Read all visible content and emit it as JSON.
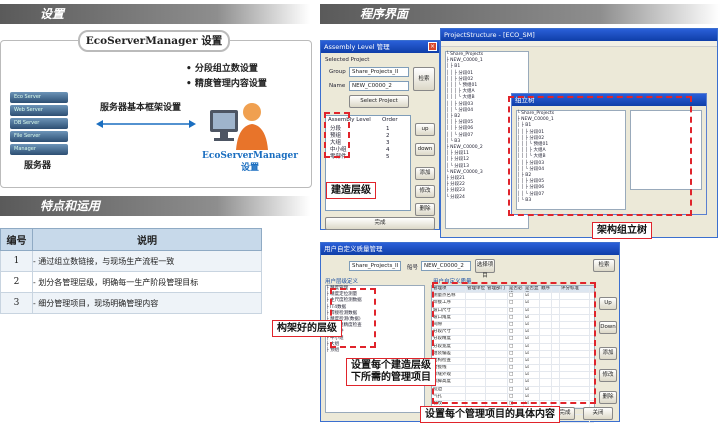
{
  "headers": {
    "settings": "设置",
    "program": "程序界面",
    "features": "特点和运用"
  },
  "setup": {
    "title": "EcoServerManager 设置",
    "bullets": [
      "分段组立数设置",
      "精度管理内容设置"
    ],
    "frame_label": "服务器基本框架设置",
    "server_label": "服务器",
    "manager_label_1": "EcoServerManager",
    "manager_label_2": "设置",
    "server_units": [
      "Eco Server",
      "Web Server",
      "DB Server",
      "File Server",
      "Manager"
    ]
  },
  "features_table": {
    "headers": [
      "编号",
      "说明"
    ],
    "rows": [
      {
        "num": "1",
        "text": "-   通过组立数链接，与现场生产流程一致"
      },
      {
        "num": "2",
        "text": "-   划分各管理层级，明确每一生产阶段管理目标"
      },
      {
        "num": "3",
        "text": "-   细分管理项目，现场明确管理内容"
      }
    ]
  },
  "assembly_window": {
    "title": "Assembly Level 管理",
    "selected_project": "Selected Project",
    "group_label": "Group",
    "group_value": "Share_Projects_II",
    "name_label": "Name",
    "name_value": "NEW_C0000_2",
    "select_button": "Select Project",
    "change_button": "检索",
    "col_level": "Assembly Level",
    "col_order": "Order",
    "levels": [
      "分段",
      "预组",
      "大组",
      "中小组",
      "零部件"
    ],
    "orders": [
      "1",
      "2",
      "3",
      "4",
      "5"
    ],
    "side_buttons": [
      "up",
      "down",
      "添加",
      "修改",
      "删除"
    ],
    "ok_button": "完成"
  },
  "main_window": {
    "title": "ProjectStructure - [ECO_SM]",
    "dialog_title": "组立树",
    "tree_items": [
      "└ Share_Projects",
      "  ├ NEW_C0000_1",
      "  │ ├ B1",
      "  │ │ ├ 分段01",
      "  │ │ ├ 分段02",
      "  │ │ │ └ 预组01",
      "  │ │ │   ├ 大组A",
      "  │ │ │   └ 大组B",
      "  │ │ ├ 分段03",
      "  │ │ └ 分段04",
      "  │ ├ B2",
      "  │ │ ├ 分段05",
      "  │ │ ├ 分段06",
      "  │ │ └ 分段07",
      "  │ └ B3",
      "  ├ NEW_C0000_2",
      "  │ ├ 分段11",
      "  │ ├ 分段12",
      "  │ └ 分段13",
      "  └ NEW_C0000_3",
      "    ├ 分段21",
      "    ├ 分段22",
      "    ├ 分段23",
      "    └ 分段24"
    ]
  },
  "user_window": {
    "title": "用户自定义质量管理",
    "group_value": "Share_Projects_II",
    "name_label": "船号",
    "name_value": "NEW_C0000_2",
    "select_button": "选择项目",
    "change_button": "检索",
    "left_title": "用户层级定义",
    "right_title": "用户自定义质量",
    "left_items": [
      "精度管理",
      "精度定位测量",
      "主尺度检测数据",
      "IT4数据",
      "焊接检测数据",
      "精度检测(数据)",
      "工作组精度检查",
      "零部件",
      "中小组",
      "大组",
      "预组"
    ],
    "grid_headers": [
      "管理项",
      "管理单位",
      "管理部门",
      "是否必填",
      "是否显示",
      "顺序",
      "",
      "评分标准"
    ],
    "grid_rows": [
      "测量点名称",
      "焊接工序",
      "坡口尺寸",
      "坡口角度",
      "间隙",
      "分段尺寸",
      "分段精度",
      "分段宽度",
      "组装偏差",
      "结构检查",
      "合拢线",
      "焊缝外观",
      "焊脚高度",
      "咬边",
      "气孔",
      "裂纹",
      "余高",
      "涂装"
    ],
    "side_buttons": [
      "Up",
      "Down",
      "添加",
      "修改",
      "删除"
    ],
    "ok_button": "完成",
    "close_button": "关闭"
  },
  "callouts": {
    "build_level": "建造层级",
    "assembly_tree": "架构组立树",
    "frame_level": "构架好的层级",
    "set_items_1": "设置每个建造层级",
    "set_items_2": "下所需的管理项目",
    "set_content": "设置每个管理项目的具体内容"
  },
  "colors": {
    "accent": "#1a6ec0",
    "callout_border": "#e0242b",
    "table_header": "#c7d9ea"
  }
}
